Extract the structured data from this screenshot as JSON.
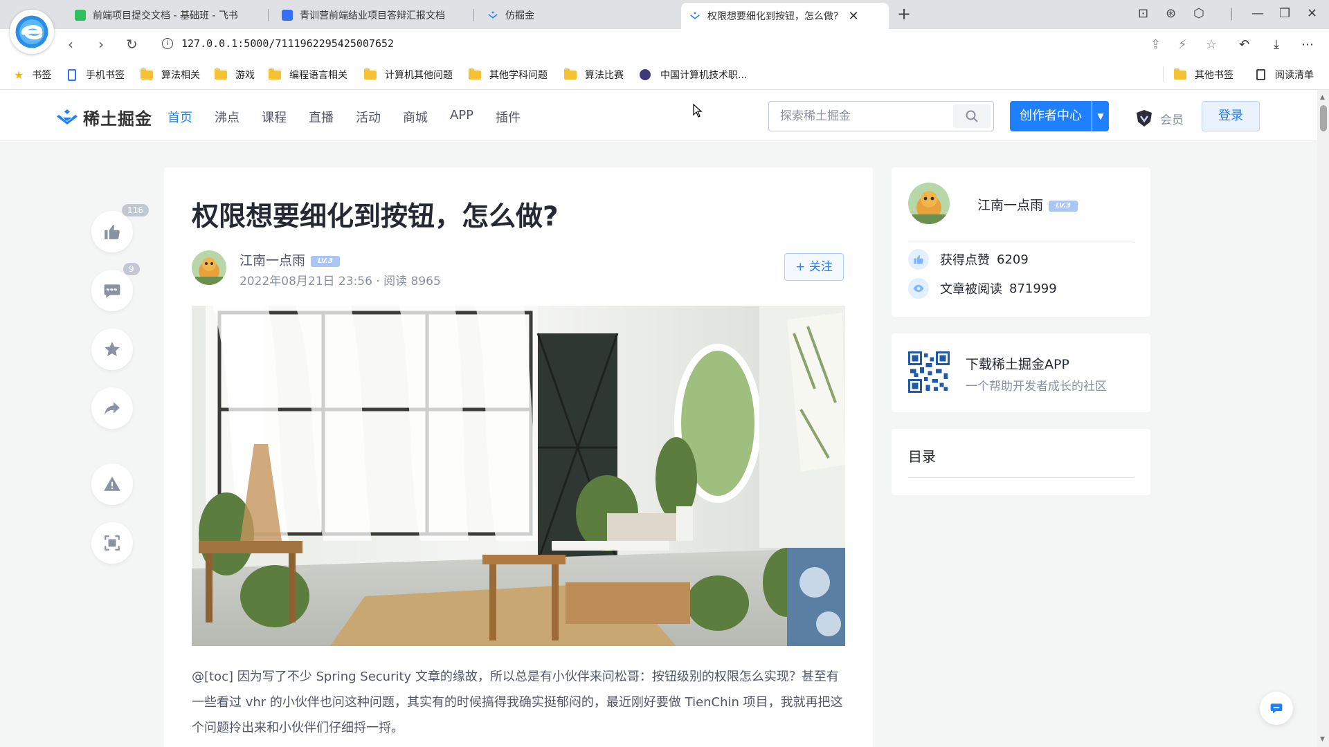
{
  "browser": {
    "tabs": [
      {
        "label": "前端项目提交文档 - 基础班 - 飞书",
        "color": "#2fbf5f"
      },
      {
        "label": "青训营前端结业项目答辩汇报文档",
        "color": "#3370ff"
      },
      {
        "label": "仿掘金",
        "color": "#1e80ff"
      },
      {
        "label": "权限想要细化到按钮，怎么做?",
        "color": "#1e80ff"
      }
    ],
    "url": "127.0.0.1:5000/7111962295425007652",
    "bookmarks": [
      {
        "label": "书签",
        "icon": "star-icon"
      },
      {
        "label": "手机书签",
        "icon": "phone-icon"
      },
      {
        "label": "算法相关",
        "icon": "folder-icon"
      },
      {
        "label": "游戏",
        "icon": "folder-icon"
      },
      {
        "label": "编程语言相关",
        "icon": "folder-icon"
      },
      {
        "label": "计算机其他问题",
        "icon": "folder-icon"
      },
      {
        "label": "其他学科问题",
        "icon": "folder-icon"
      },
      {
        "label": "算法比赛",
        "icon": "folder-icon"
      },
      {
        "label": "中国计算机技术职...",
        "icon": "site-icon"
      }
    ],
    "bookmarks_right": [
      {
        "label": "其他书签"
      },
      {
        "label": "阅读清单"
      }
    ]
  },
  "site": {
    "brand": "稀土掘金",
    "nav": [
      "首页",
      "沸点",
      "课程",
      "直播",
      "活动",
      "商城",
      "APP",
      "插件"
    ],
    "nav_active": "首页",
    "search_placeholder": "探索稀土掘金",
    "creator_label": "创作者中心",
    "member_label": "会员",
    "login_label": "登录",
    "accent": "#1e80ff"
  },
  "rail": {
    "like_count": "116",
    "comment_count": "9"
  },
  "article": {
    "title": "权限想要细化到按钮，怎么做?",
    "author": "江南一点雨",
    "level": "LV.3",
    "date": "2022年08月21日 23:56 ·  阅读 8965",
    "follow_label": "+ 关注",
    "body": "@[toc] 因为写了不少 Spring Security 文章的缘故，所以总是有小伙伴来问松哥：按钮级别的权限怎么实现？甚至有一些看过 vhr 的小伙伴也问这种问题，其实有的时候搞得我确实挺郁闷的，最近刚好要做 TienChin 项目，我就再把这个问题拎出来和小伙伴们仔细捋一捋。"
  },
  "sidebar": {
    "author_name": "江南一点雨",
    "level": "LV.3",
    "likes_label": "获得点赞",
    "likes_value": "6209",
    "reads_label": "文章被阅读",
    "reads_value": "871999",
    "app_title": "下载稀土掘金APP",
    "app_subtitle": "一个帮助开发者成长的社区",
    "toc_title": "目录"
  }
}
